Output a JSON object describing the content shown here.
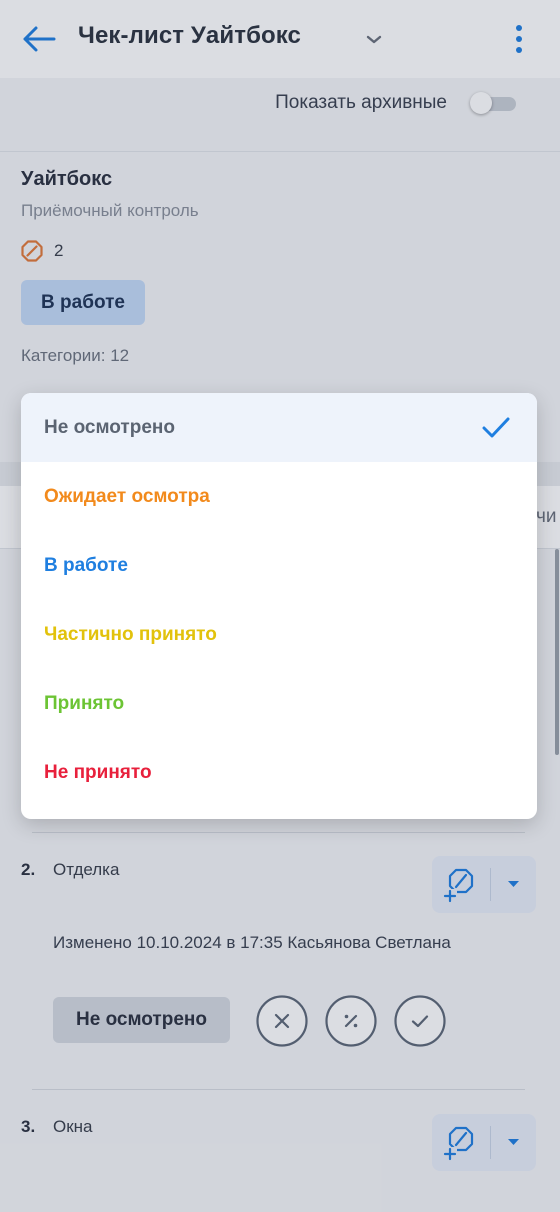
{
  "header": {
    "title": "Чек-лист Уайтбокс"
  },
  "archive": {
    "label": "Показать архивные",
    "enabled": false
  },
  "card": {
    "name": "Уайтбокс",
    "subtitle": "Приёмочный контроль",
    "issue_count": "2",
    "status": "В работе",
    "categories": "Категории: 12"
  },
  "tab_peek": "чи",
  "items": [
    {
      "number": "2.",
      "title": "Отделка",
      "changed": "Изменено 10.10.2024 в 17:35 Касьянова Светлана",
      "status": "Не осмотрено"
    },
    {
      "number": "3.",
      "title": "Окна"
    }
  ],
  "dropdown": {
    "options": [
      {
        "label": "Не осмотрено",
        "color": "#5b6472",
        "selected": true
      },
      {
        "label": "Ожидает осмотра",
        "color": "#f28a1c",
        "selected": false
      },
      {
        "label": "В работе",
        "color": "#1f7fe0",
        "selected": false
      },
      {
        "label": "Частично принято",
        "color": "#e2c20c",
        "selected": false
      },
      {
        "label": "Принято",
        "color": "#6cc434",
        "selected": false
      },
      {
        "label": "Не принято",
        "color": "#e8203c",
        "selected": false
      }
    ]
  },
  "colors": {
    "accent": "#1f7fe0",
    "issue_icon": "#e27a3a"
  }
}
